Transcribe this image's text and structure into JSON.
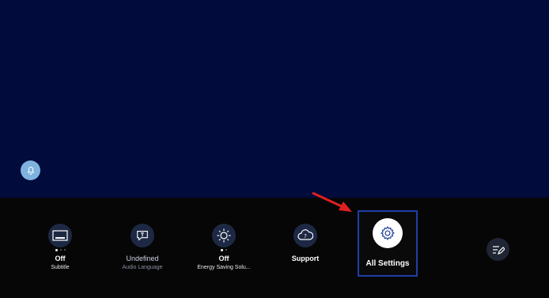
{
  "notification": {
    "icon": "bell-icon"
  },
  "quick_settings": [
    {
      "primary": "Off",
      "secondary": "Subtitle",
      "icon": "subtitle-icon"
    },
    {
      "primary": "Undefined",
      "secondary": "Audio Language",
      "icon": "audio-language-icon"
    },
    {
      "primary": "Off",
      "secondary": "Energy Saving Solu...",
      "icon": "energy-saving-icon"
    },
    {
      "primary": "Support",
      "secondary": "",
      "icon": "support-icon"
    },
    {
      "primary": "All Settings",
      "secondary": "",
      "icon": "gear-icon"
    }
  ],
  "edit": {
    "icon": "edit-list-icon"
  },
  "colors": {
    "background": "#010b3c",
    "tray": "#060606",
    "selection_border": "#1f3fa8",
    "annotation_arrow": "#e02020"
  }
}
